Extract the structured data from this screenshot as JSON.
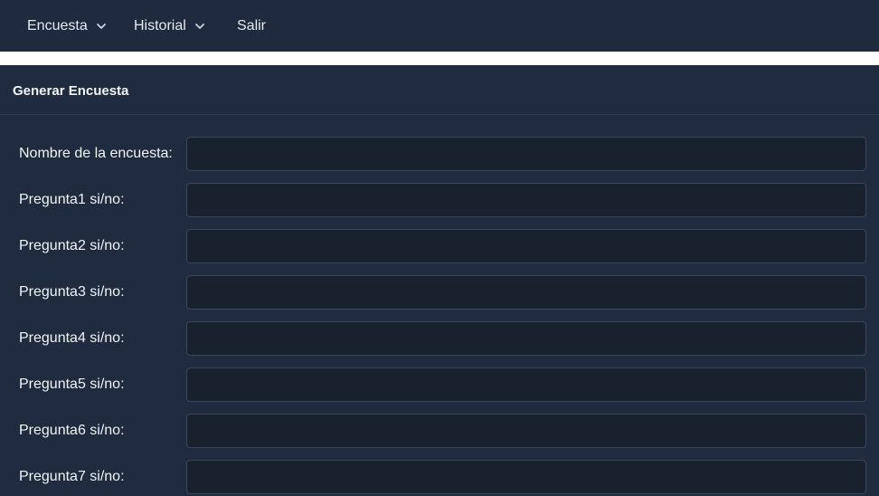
{
  "navbar": {
    "items": [
      {
        "label": "Encuesta",
        "has_dropdown": true
      },
      {
        "label": "Historial",
        "has_dropdown": true
      },
      {
        "label": "Salir",
        "has_dropdown": false
      }
    ]
  },
  "card": {
    "title": "Generar Encuesta"
  },
  "form": {
    "fields": [
      {
        "label": "Nombre de la encuesta:",
        "value": ""
      },
      {
        "label": "Pregunta1 si/no:",
        "value": ""
      },
      {
        "label": "Pregunta2 si/no:",
        "value": ""
      },
      {
        "label": "Pregunta3 si/no:",
        "value": ""
      },
      {
        "label": "Pregunta4 si/no:",
        "value": ""
      },
      {
        "label": "Pregunta5 si/no:",
        "value": ""
      },
      {
        "label": "Pregunta6 si/no:",
        "value": ""
      },
      {
        "label": "Pregunta7 si/no:",
        "value": ""
      }
    ]
  },
  "colors": {
    "background": "#1e2a3d",
    "input_background": "#19202e",
    "input_border": "#3a4659",
    "text": "#ffffff"
  },
  "icons": {
    "dropdown": "chevron-down-icon"
  }
}
